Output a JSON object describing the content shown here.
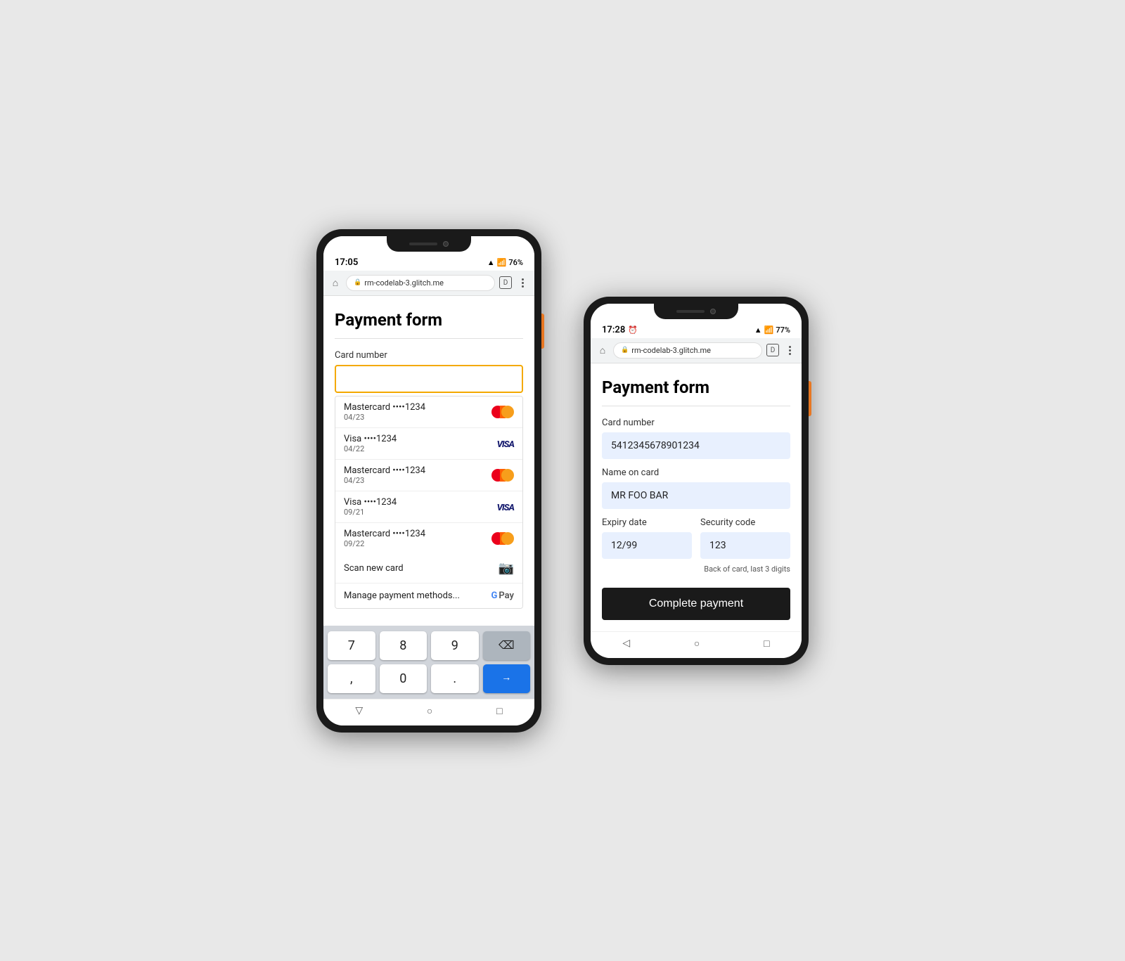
{
  "left_phone": {
    "status": {
      "time": "17:05",
      "signal": "▲▼",
      "battery": "76%"
    },
    "browser": {
      "url": "rm-codelab-3.glitch.me",
      "tab_label": "D"
    },
    "page": {
      "title": "Payment form",
      "card_number_label": "Card number",
      "card_placeholder": ""
    },
    "saved_cards": [
      {
        "brand": "Mastercard",
        "last4": "••••1234",
        "expiry": "04/23",
        "type": "mastercard"
      },
      {
        "brand": "Visa",
        "last4": "••••1234",
        "expiry": "04/22",
        "type": "visa"
      },
      {
        "brand": "Mastercard",
        "last4": "••••1234",
        "expiry": "04/23",
        "type": "mastercard"
      },
      {
        "brand": "Visa",
        "last4": "••••1234",
        "expiry": "09/21",
        "type": "visa"
      },
      {
        "brand": "Mastercard",
        "last4": "••••1234",
        "expiry": "09/22",
        "type": "mastercard"
      }
    ],
    "scan_label": "Scan new card",
    "manage_label": "Manage payment methods...",
    "keyboard": {
      "row1": [
        "7",
        "8",
        "9"
      ],
      "row2": [
        ",",
        "0",
        "."
      ],
      "delete": "⌫",
      "arrow": "→"
    }
  },
  "right_phone": {
    "status": {
      "time": "17:28",
      "signal": "▲▼",
      "battery": "77%"
    },
    "browser": {
      "url": "rm-codelab-3.glitch.me",
      "tab_label": "D"
    },
    "page": {
      "title": "Payment form",
      "card_number_label": "Card number",
      "card_number_value": "5412345678901234",
      "name_label": "Name on card",
      "name_value": "MR FOO BAR",
      "expiry_label": "Expiry date",
      "expiry_value": "12/99",
      "security_label": "Security code",
      "security_value": "123",
      "security_hint": "Back of card, last 3 digits",
      "complete_btn": "Complete payment"
    }
  }
}
